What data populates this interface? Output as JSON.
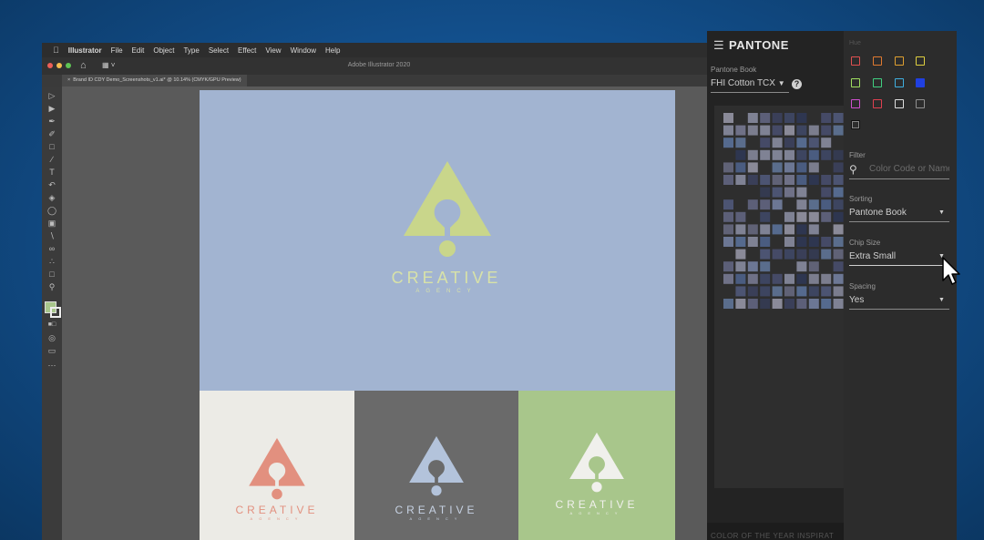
{
  "illustrator": {
    "menu": [
      "Illustrator",
      "File",
      "Edit",
      "Object",
      "Type",
      "Select",
      "Effect",
      "View",
      "Window",
      "Help"
    ],
    "window_title": "Adobe Illustrator 2020",
    "document_tab": "Brand ID CDY Demo_Screenshots_v1.ai* @ 10.14% (CMYK/GPU Preview)",
    "logo_title": "CREATIVE",
    "logo_subtitle": "AGENCY",
    "colors": {
      "artboard_main": "#a2b4d1",
      "logo_main": "#c9d68b",
      "card1_bg": "#ecebe6",
      "card1_logo": "#e2907f",
      "card2_bg": "#6a6a6a",
      "card2_logo": "#b3c3db",
      "card3_bg": "#a8c68b",
      "card3_logo": "#f0f0ec"
    }
  },
  "pantone": {
    "brand": "PANTONE",
    "pantone_book_label": "Pantone Book",
    "pantone_book_value": "FHI Cotton TCX",
    "hue_label": "Hue",
    "hue_swatch_colors": [
      "#e05050",
      "#e07a30",
      "#e0a030",
      "#e0d040",
      "#a0e060",
      "#40d080",
      "#40b0e0",
      "#2040e0",
      "#d050d0",
      "#e04050",
      "#e0e0e0",
      "#909090",
      "#202020"
    ],
    "filter_label": "Filter",
    "filter_placeholder": "Color Code or Name",
    "sorting_label": "Sorting",
    "sorting_value": "Pantone Book",
    "chip_size_label": "Chip Size",
    "chip_size_value": "Extra Small",
    "spacing_label": "Spacing",
    "spacing_value": "Yes",
    "footer_text": "COLOR OF THE YEAR INSPIRAT"
  }
}
